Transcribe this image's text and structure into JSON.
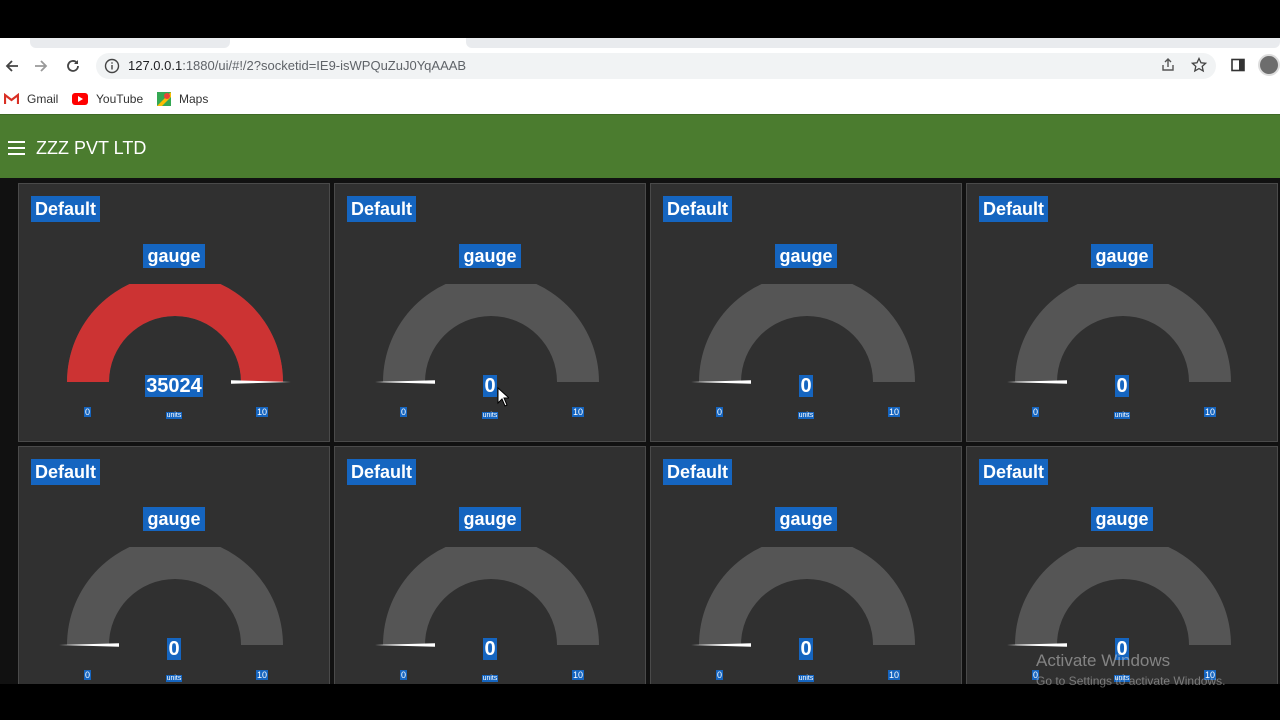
{
  "browser": {
    "url_host": "127.0.0.1",
    "url_path": ":1880/ui/#!/2?socketid=IE9-isWPQuZuJ0YqAAAB",
    "bookmarks": [
      {
        "label": "Gmail",
        "icon": "gmail-icon"
      },
      {
        "label": "YouTube",
        "icon": "youtube-icon"
      },
      {
        "label": "Maps",
        "icon": "maps-icon"
      }
    ]
  },
  "app": {
    "title": "ZZZ PVT LTD",
    "accent_color": "#4b7c2f"
  },
  "gauges": [
    {
      "group": "Default",
      "title": "gauge",
      "value": "35024",
      "units": "units",
      "min": "0",
      "max": "10",
      "fill_fraction": 1.0,
      "color": "#cc3333"
    },
    {
      "group": "Default",
      "title": "gauge",
      "value": "0",
      "units": "units",
      "min": "0",
      "max": "10",
      "fill_fraction": 0.0,
      "color": "#cc3333"
    },
    {
      "group": "Default",
      "title": "gauge",
      "value": "0",
      "units": "units",
      "min": "0",
      "max": "10",
      "fill_fraction": 0.0,
      "color": "#cc3333"
    },
    {
      "group": "Default",
      "title": "gauge",
      "value": "0",
      "units": "units",
      "min": "0",
      "max": "10",
      "fill_fraction": 0.0,
      "color": "#cc3333"
    },
    {
      "group": "Default",
      "title": "gauge",
      "value": "0",
      "units": "units",
      "min": "0",
      "max": "10",
      "fill_fraction": 0.0,
      "color": "#cc3333"
    },
    {
      "group": "Default",
      "title": "gauge",
      "value": "0",
      "units": "units",
      "min": "0",
      "max": "10",
      "fill_fraction": 0.0,
      "color": "#cc3333"
    },
    {
      "group": "Default",
      "title": "gauge",
      "value": "0",
      "units": "units",
      "min": "0",
      "max": "10",
      "fill_fraction": 0.0,
      "color": "#cc3333"
    },
    {
      "group": "Default",
      "title": "gauge",
      "value": "0",
      "units": "units",
      "min": "0",
      "max": "10",
      "fill_fraction": 0.0,
      "color": "#cc3333"
    }
  ],
  "os_watermark": {
    "line1": "Activate Windows",
    "line2": "Go to Settings to activate Windows."
  }
}
